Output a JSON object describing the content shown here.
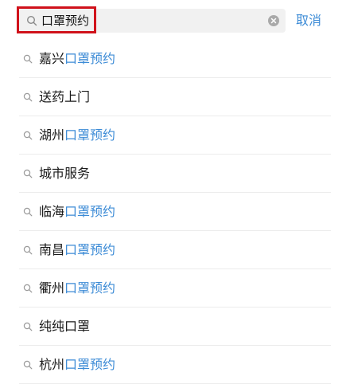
{
  "search": {
    "value": "口罩预约",
    "cancel_label": "取消"
  },
  "suggestions": [
    {
      "prefix": "嘉兴",
      "match": "口罩预约"
    },
    {
      "prefix": "送药上门",
      "match": ""
    },
    {
      "prefix": "湖州",
      "match": "口罩预约"
    },
    {
      "prefix": "城市服务",
      "match": ""
    },
    {
      "prefix": "临海",
      "match": "口罩预约"
    },
    {
      "prefix": "南昌",
      "match": "口罩预约"
    },
    {
      "prefix": "衢州",
      "match": "口罩预约"
    },
    {
      "prefix": "纯纯口罩",
      "match": ""
    },
    {
      "prefix": "杭州",
      "match": "口罩预约"
    }
  ],
  "colors": {
    "accent": "#3c8bd6",
    "highlight_border": "#d0121b",
    "search_box_bg": "#f1f1f1"
  },
  "icons": {
    "search": "search-icon",
    "clear": "clear-icon",
    "suggestion": "search-icon"
  }
}
